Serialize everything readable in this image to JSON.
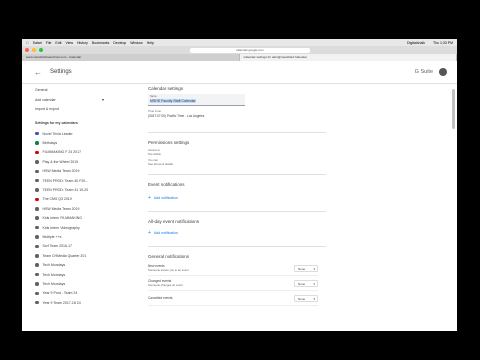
{
  "menubar": {
    "items": [
      "Safari",
      "File",
      "Edit",
      "View",
      "History",
      "Bookmarks",
      "Develop",
      "Window",
      "Help"
    ],
    "right": [
      "Digitalchalk",
      "Thu 1:33 PM"
    ]
  },
  "browser": {
    "url": "calendar.google.com",
    "tabs": [
      "www.mansfieldtrueschool.com - Calendar",
      "Calendar settings for adm@mansfield Calendar"
    ]
  },
  "app": {
    "title": "Settings",
    "product": "G Suite"
  },
  "sidebar": {
    "general": "General",
    "add_calendar": "Add calendar",
    "import_export": "Import & export",
    "cal_header": "Settings for my calendars",
    "calendars": [
      {
        "name": "Novel Trivia Leader",
        "color": "#3f51b5"
      },
      {
        "name": "Birthdays",
        "color": "#0b8043"
      },
      {
        "name": "FILMMAKING F 24 2017",
        "color": "#d50000"
      },
      {
        "name": "Play & the Wheel 2019",
        "color": "#616161"
      },
      {
        "name": "HSW Media Team 2019",
        "color": "#616161"
      },
      {
        "name": "TEEN PROD: Team 40 F20...",
        "color": "#616161"
      },
      {
        "name": "TEEN PROD: Team 41 19-20",
        "color": "#616161"
      },
      {
        "name": "The CMS Q3 2019",
        "color": "#d50000"
      },
      {
        "name": "HSW Media Team 2019",
        "color": "#616161"
      },
      {
        "name": "Kids Intern FILMMAKING",
        "color": "#616161"
      },
      {
        "name": "Kids Intern Videography",
        "color": "#616161"
      },
      {
        "name": "Multiple ++s",
        "color": "#616161"
      },
      {
        "name": "Scrf Team 2016-17",
        "color": "#616161"
      },
      {
        "name": "Team CHMedia Quarter 201",
        "color": "#616161"
      },
      {
        "name": "Tech Mondays",
        "color": "#616161"
      },
      {
        "name": "Tech Mondays",
        "color": "#616161"
      },
      {
        "name": "Tech Mondays",
        "color": "#616161"
      },
      {
        "name": "Year 9 Prod - Team 24",
        "color": "#616161"
      },
      {
        "name": "Year 9 Team 2017-18 24",
        "color": "#616161"
      }
    ]
  },
  "main": {
    "calendar_settings": "Calendar settings",
    "name_label": "Name",
    "name_value": "MSHS Faculty Staff Calendar",
    "timezone_label": "Time zone",
    "timezone_value": "(GMT-07:00) Pacific Time - Los Angeles",
    "permissions": "Permissions settings",
    "access_label": "Access is",
    "access_value": "Not visible",
    "you_label": "You can",
    "you_value": "See all event details",
    "event_notifications": "Event notifications",
    "add_notification": "Add notification",
    "allday_notifications": "All-day event notifications",
    "add_notification_2": "Add notification",
    "general_notifications": "General notifications",
    "notif_rows": [
      {
        "label": "New events",
        "desc": "Someone invites you to an event",
        "value": "None"
      },
      {
        "label": "Changed events",
        "desc": "Someone changes an event",
        "value": "None"
      },
      {
        "label": "Cancelled events",
        "desc": "",
        "value": "None"
      }
    ]
  }
}
